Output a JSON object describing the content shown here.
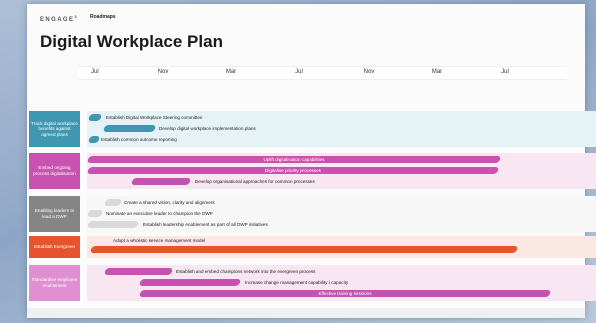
{
  "header": {
    "brand": "ENGAGE",
    "brand_mark": "3",
    "breadcrumb": "Roadmaps",
    "title": "Digital Workplace Plan"
  },
  "timeline": {
    "months": [
      "Jul",
      "Nov",
      "Mar",
      "Jul",
      "Nov",
      "Mar",
      "Jul"
    ]
  },
  "lanes": [
    {
      "label": "Track digital workplace benefits against agreed plans",
      "label_color": "#3f97b2",
      "bg_color": "#e6f3f6",
      "items": [
        {
          "text": "Establish Digital Workplace Steering committee",
          "color": "#3f97b2"
        },
        {
          "text": "Develop digital workplace implementation plans",
          "color": "#3f97b2"
        },
        {
          "text": "Establish common outcome reporting",
          "color": "#3f97b2"
        }
      ]
    },
    {
      "label": "Embed ongoing process digitalisation",
      "label_color": "#c752b0",
      "bg_color": "#f8e6f3",
      "items": [
        {
          "text": "Uplift digitalisation capabilities",
          "color": "#c752b0"
        },
        {
          "text": "Digitalise priority processes",
          "color": "#c752b0"
        },
        {
          "text": "Develop organisational approaches for common processes",
          "color": "#c752b0"
        }
      ]
    },
    {
      "label": "Enabling leaders to lead a DWP",
      "label_color": "#858585",
      "bg_color": "#f7f7f7",
      "items": [
        {
          "text": "Create a shared vision, clarity and alignment",
          "color": "#d9d9d9"
        },
        {
          "text": "Nominate an executive leader to champion the DWP",
          "color": "#d9d9d9"
        },
        {
          "text": "Establish leadership enablement as part of all DWP initiatives",
          "color": "#d9d9d9"
        }
      ]
    },
    {
      "label": "Establish Evergreen",
      "label_color": "#e5532f",
      "bg_color": "#fbe8e3",
      "items": [
        {
          "text": "Adopt a wholistic service management model",
          "color": "#e5532f"
        }
      ]
    },
    {
      "label": "Standardise employee enablement",
      "label_color": "#e08fd0",
      "bg_color": "#f8e6f3",
      "items": [
        {
          "text": "Establish and embed champions network into the evergreen process",
          "color": "#c752b0"
        },
        {
          "text": "Increase change management capability / capacity",
          "color": "#c752b0"
        },
        {
          "text": "Effective training sessions",
          "color": "#c752b0"
        }
      ]
    }
  ]
}
